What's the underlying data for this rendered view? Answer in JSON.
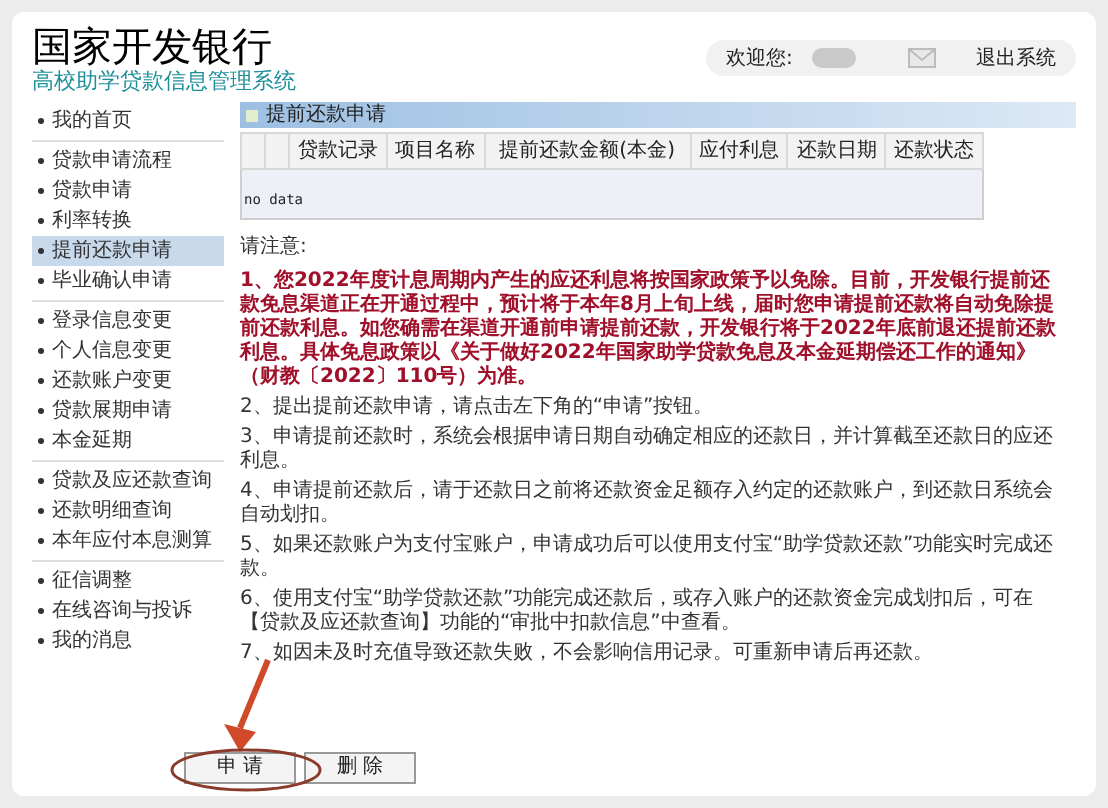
{
  "header": {
    "title": "国家开发银行",
    "subtitle": "高校助学贷款信息管理系统",
    "welcome": "欢迎您:",
    "logout": "退出系统"
  },
  "sidebar": {
    "groups": [
      [
        {
          "label": "我的首页",
          "selected": false
        }
      ],
      [
        {
          "label": "贷款申请流程",
          "selected": false
        },
        {
          "label": "贷款申请",
          "selected": false
        },
        {
          "label": "利率转换",
          "selected": false
        },
        {
          "label": "提前还款申请",
          "selected": true
        },
        {
          "label": "毕业确认申请",
          "selected": false
        }
      ],
      [
        {
          "label": "登录信息变更",
          "selected": false
        },
        {
          "label": "个人信息变更",
          "selected": false
        },
        {
          "label": "还款账户变更",
          "selected": false
        },
        {
          "label": "贷款展期申请",
          "selected": false
        },
        {
          "label": "本金延期",
          "selected": false
        }
      ],
      [
        {
          "label": "贷款及应还款查询",
          "selected": false
        },
        {
          "label": "还款明细查询",
          "selected": false
        },
        {
          "label": "本年应付本息测算",
          "selected": false
        }
      ],
      [
        {
          "label": "征信调整",
          "selected": false
        },
        {
          "label": "在线咨询与投诉",
          "selected": false
        },
        {
          "label": "我的消息",
          "selected": false
        }
      ]
    ]
  },
  "panel": {
    "title": "提前还款申请"
  },
  "table": {
    "columns": [
      "",
      "",
      "贷款记录",
      "项目名称",
      "提前还款金额(本金)",
      "应付利息",
      "还款日期",
      "还款状态"
    ],
    "empty": "no data"
  },
  "notes": {
    "heading": "请注意:",
    "items": [
      {
        "kind": "important",
        "text": "1、您2022年度计息周期内产生的应还利息将按国家政策予以免除。目前，开发银行提前还款免息渠道正在开通过程中，预计将于本年8月上旬上线，届时您申请提前还款将自动免除提前还款利息。如您确需在渠道开通前申请提前还款，开发银行将于2022年底前退还提前还款利息。具体免息政策以《关于做好2022年国家助学贷款免息及本金延期偿还工作的通知》（财教〔2022〕110号）为准。"
      },
      {
        "kind": "normal",
        "text": "2、提出提前还款申请，请点击左下角的“申请”按钮。"
      },
      {
        "kind": "normal",
        "text": "3、申请提前还款时，系统会根据申请日期自动确定相应的还款日，并计算截至还款日的应还利息。"
      },
      {
        "kind": "normal",
        "text": "4、申请提前还款后，请于还款日之前将还款资金足额存入约定的还款账户，到还款日系统会自动划扣。"
      },
      {
        "kind": "normal",
        "text": "5、如果还款账户为支付宝账户，申请成功后可以使用支付宝“助学贷款还款”功能实时完成还款。"
      },
      {
        "kind": "normal",
        "text": "6、使用支付宝“助学贷款还款”功能完成还款后，或存入账户的还款资金完成划扣后，可在【贷款及应还款查询】功能的“审批中扣款信息”中查看。"
      },
      {
        "kind": "normal",
        "text": "7、如因未及时充值导致还款失败，不会影响信用记录。可重新申请后再还款。"
      }
    ]
  },
  "buttons": [
    "申 请",
    "删 除"
  ]
}
